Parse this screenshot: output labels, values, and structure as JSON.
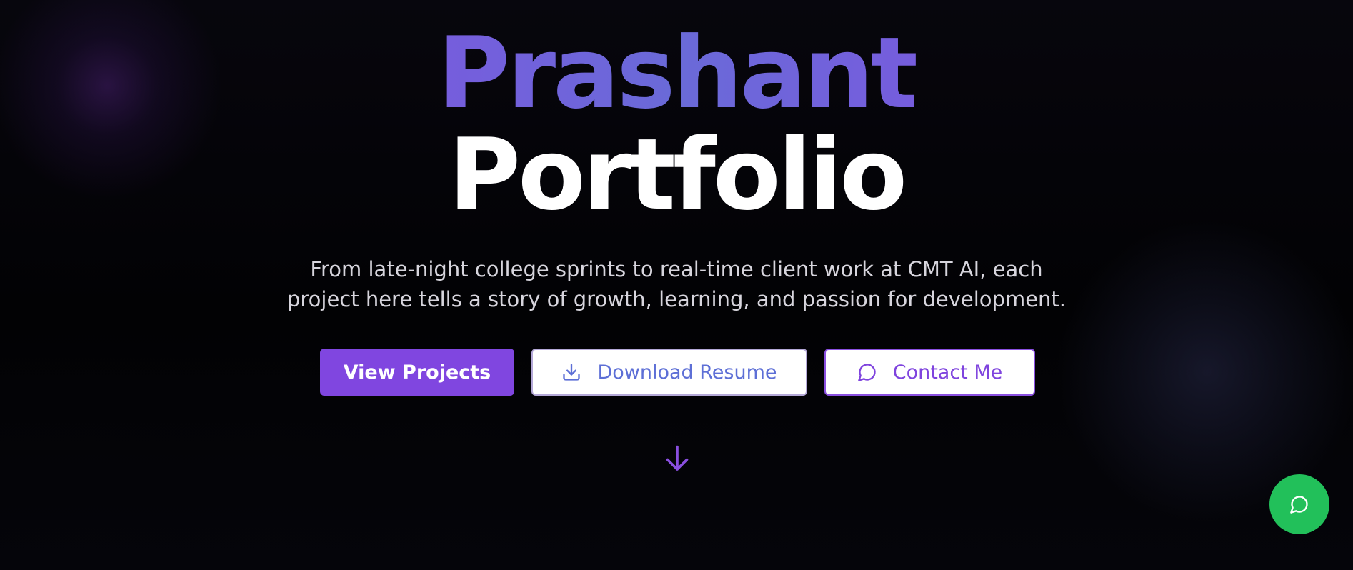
{
  "hero": {
    "title_line1": "Prashant",
    "title_line2": "Portfolio",
    "subtitle": "From late-night college sprints to real-time client work at CMT AI, each project here tells a story of growth, learning, and passion for development."
  },
  "buttons": {
    "view_projects": "View Projects",
    "download_resume": "Download Resume",
    "contact_me": "Contact Me"
  },
  "icons": {
    "download": "download-icon",
    "contact": "chat-bubble-icon",
    "scroll": "arrow-down-icon",
    "fab": "chat-bubble-icon"
  },
  "colors": {
    "accent_purple": "#8046e0",
    "accent_blue": "#5d6fd6",
    "fab_green": "#22c05a",
    "background": "#040308"
  }
}
